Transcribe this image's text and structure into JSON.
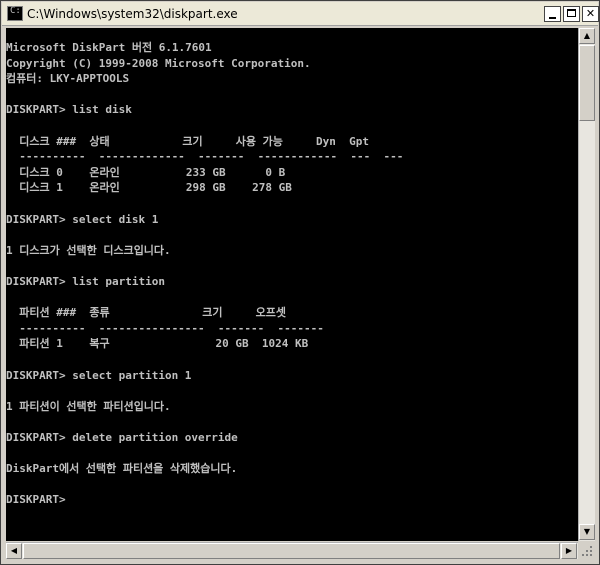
{
  "window": {
    "title": "C:\\Windows\\system32\\diskpart.exe",
    "controls": {
      "minimize": "",
      "maximize": "",
      "close": "✕"
    }
  },
  "console": {
    "lines": [
      "Microsoft DiskPart 버전 6.1.7601",
      "Copyright (C) 1999-2008 Microsoft Corporation.",
      "컴퓨터: LKY-APPTOOLS",
      "",
      "DISKPART> list disk",
      "",
      "  디스크 ###  상태           크기     사용 가능     Dyn  Gpt",
      "  ----------  -------------  -------  ------------  ---  ---",
      "  디스크 0    온라인          233 GB      0 B",
      "  디스크 1    온라인          298 GB    278 GB",
      "",
      "DISKPART> select disk 1",
      "",
      "1 디스크가 선택한 디스크입니다.",
      "",
      "DISKPART> list partition",
      "",
      "  파티션 ###  종류              크기     오프셋",
      "  ----------  ----------------  -------  -------",
      "  파티션 1    복구                20 GB  1024 KB",
      "",
      "DISKPART> select partition 1",
      "",
      "1 파티션이 선택한 파티션입니다.",
      "",
      "DISKPART> delete partition override",
      "",
      "DiskPart에서 선택한 파티션을 삭제했습니다.",
      "",
      "DISKPART>"
    ]
  },
  "scrollbars": {
    "up_arrow": "▲",
    "down_arrow": "▼",
    "left_arrow": "◀",
    "right_arrow": "▶"
  }
}
